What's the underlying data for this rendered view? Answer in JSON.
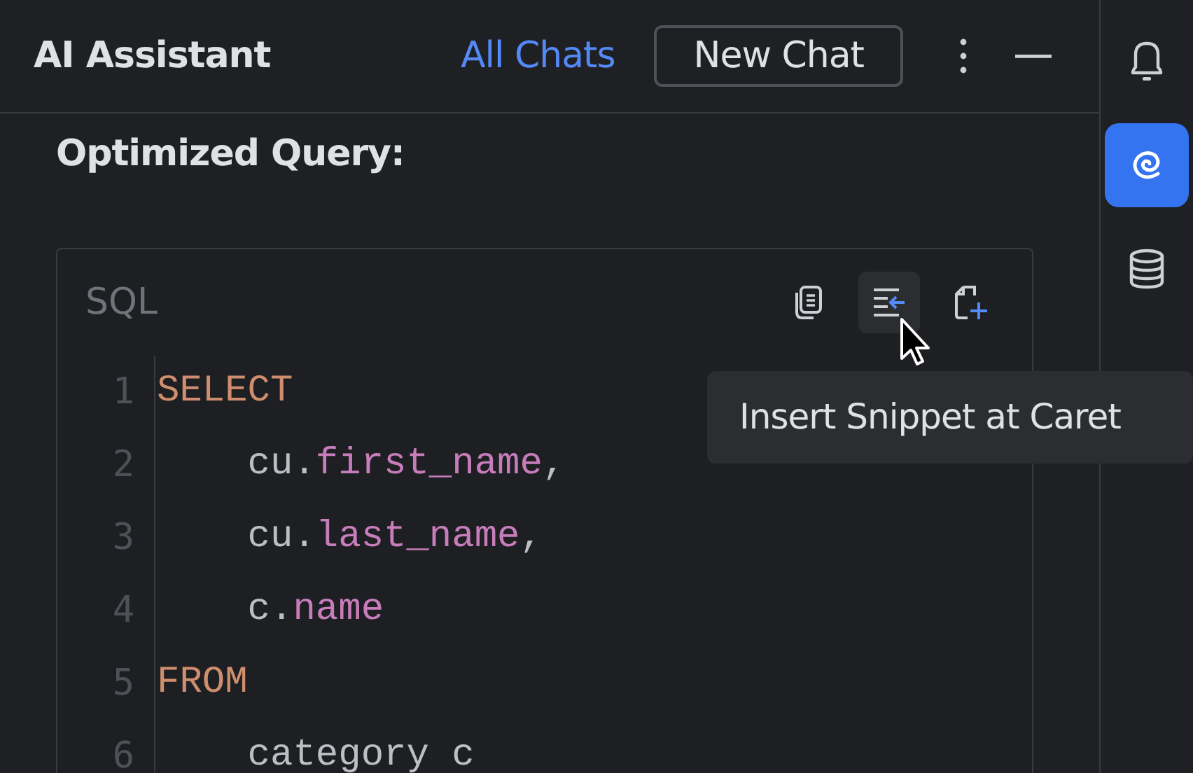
{
  "header": {
    "title": "AI Assistant",
    "link": "All Chats",
    "button": "New Chat"
  },
  "heading": "Optimized Query:",
  "code_block": {
    "language": "SQL",
    "toolbar": [
      {
        "kind": "copy",
        "hovered": false
      },
      {
        "kind": "insert",
        "hovered": true
      },
      {
        "kind": "new-file",
        "hovered": false
      }
    ],
    "tooltip": "Insert Snippet at Caret",
    "lines": [
      {
        "number": "1",
        "tokens": [
          {
            "kind": "keyword",
            "text": "SELECT"
          }
        ]
      },
      {
        "number": "2",
        "tokens": [
          {
            "kind": "plain",
            "text": "    cu."
          },
          {
            "kind": "field",
            "text": "first_name"
          },
          {
            "kind": "plain",
            "text": ","
          }
        ]
      },
      {
        "number": "3",
        "tokens": [
          {
            "kind": "plain",
            "text": "    cu."
          },
          {
            "kind": "field",
            "text": "last_name"
          },
          {
            "kind": "plain",
            "text": ","
          }
        ]
      },
      {
        "number": "4",
        "tokens": [
          {
            "kind": "plain",
            "text": "    c."
          },
          {
            "kind": "field",
            "text": "name"
          }
        ]
      },
      {
        "number": "5",
        "tokens": [
          {
            "kind": "keyword",
            "text": "FROM"
          }
        ]
      },
      {
        "number": "6",
        "tokens": [
          {
            "kind": "plain",
            "text": "    category c"
          }
        ]
      }
    ]
  },
  "sidebar": {
    "items": [
      {
        "kind": "bell",
        "selected": false
      },
      {
        "kind": "ai",
        "selected": true
      },
      {
        "kind": "database",
        "selected": false
      }
    ]
  }
}
